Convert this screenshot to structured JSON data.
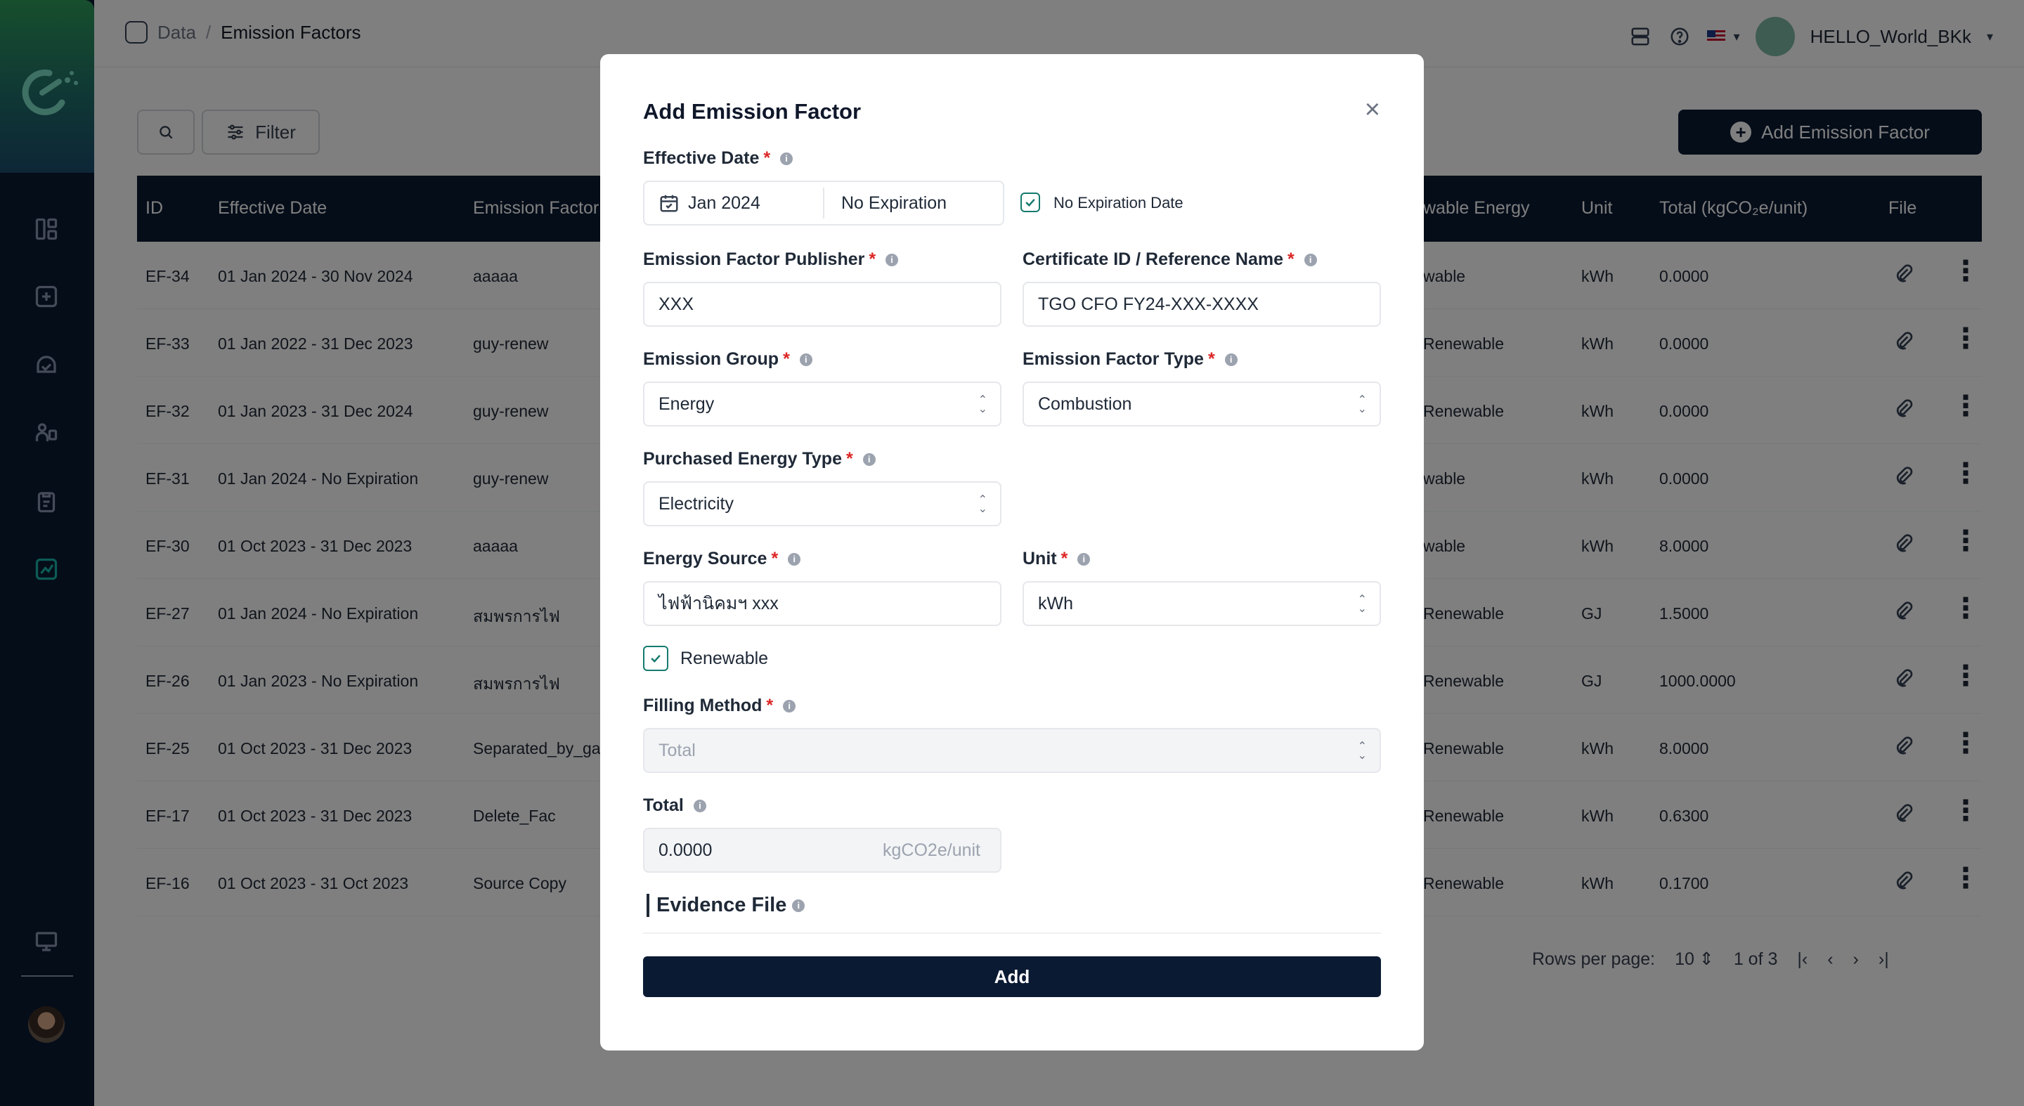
{
  "breadcrumb": {
    "parent": "Data",
    "current": "Emission Factors"
  },
  "header": {
    "username": "HELLO_World_BKk"
  },
  "toolbar": {
    "filter_label": "Filter",
    "add_label": "Add Emission Factor"
  },
  "table": {
    "headers": {
      "id": "ID",
      "effective_date": "Effective Date",
      "emission_factor": "Emission Factor",
      "renewable_energy": "wable Energy",
      "unit": "Unit",
      "total": "Total (kgCO₂e/unit)",
      "file": "File"
    },
    "rows": [
      {
        "id": "EF-34",
        "date": "01 Jan 2024 - 30 Nov 2024",
        "name": "aaaaa",
        "renew": "wable",
        "unit": "kWh",
        "total": "0.0000"
      },
      {
        "id": "EF-33",
        "date": "01 Jan 2022 - 31 Dec 2023",
        "name": "guy-renew",
        "renew": "Renewable",
        "unit": "kWh",
        "total": "0.0000"
      },
      {
        "id": "EF-32",
        "date": "01 Jan 2023 - 31 Dec 2024",
        "name": "guy-renew",
        "renew": "Renewable",
        "unit": "kWh",
        "total": "0.0000"
      },
      {
        "id": "EF-31",
        "date": "01 Jan 2024 - No Expiration",
        "name": "guy-renew",
        "renew": "wable",
        "unit": "kWh",
        "total": "0.0000"
      },
      {
        "id": "EF-30",
        "date": "01 Oct 2023 - 31 Dec 2023",
        "name": "aaaaa",
        "renew": "wable",
        "unit": "kWh",
        "total": "8.0000"
      },
      {
        "id": "EF-27",
        "date": "01 Jan 2024 - No Expiration",
        "name": "สมพรการไฟ",
        "renew": "Renewable",
        "unit": "GJ",
        "total": "1.5000"
      },
      {
        "id": "EF-26",
        "date": "01 Jan 2023 - No Expiration",
        "name": "สมพรการไฟ",
        "renew": "Renewable",
        "unit": "GJ",
        "total": "1000.0000"
      },
      {
        "id": "EF-25",
        "date": "01 Oct 2023 - 31 Dec 2023",
        "name": "Separated_by_gas",
        "renew": "Renewable",
        "unit": "kWh",
        "total": "8.0000"
      },
      {
        "id": "EF-17",
        "date": "01 Oct 2023 - 31 Dec 2023",
        "name": "Delete_Fac",
        "renew": "Renewable",
        "unit": "kWh",
        "total": "0.6300"
      },
      {
        "id": "EF-16",
        "date": "01 Oct 2023 - 31 Oct 2023",
        "name": "Source Copy",
        "renew": "Renewable",
        "unit": "kWh",
        "total": "0.1700"
      }
    ]
  },
  "pagination": {
    "rows_label": "Rows per page:",
    "rows_value": "10",
    "page_info": "1 of 3"
  },
  "modal": {
    "title": "Add Emission Factor",
    "effective_date_label": "Effective Date",
    "start_date": "Jan 2024",
    "end_date": "No Expiration",
    "no_expiration_label": "No Expiration Date",
    "publisher_label": "Emission Factor Publisher",
    "publisher_value": "XXX",
    "certificate_label": "Certificate ID / Reference Name",
    "certificate_value": "TGO CFO FY24-XXX-XXXX",
    "group_label": "Emission Group",
    "group_value": "Energy",
    "type_label": "Emission Factor Type",
    "type_value": "Combustion",
    "purchased_label": "Purchased Energy Type",
    "purchased_value": "Electricity",
    "source_label": "Energy Source",
    "source_value": "ไฟฟ้านิคมฯ xxx",
    "unit_label": "Unit",
    "unit_value": "kWh",
    "renewable_label": "Renewable",
    "filling_label": "Filling Method",
    "filling_value": "Total",
    "total_label": "Total",
    "total_value": "0.0000",
    "total_unit": "kgCO2e/unit",
    "evidence_label": "Evidence File",
    "add_label": "Add"
  },
  "colors": {
    "navy": "#0b1a33",
    "teal": "#157a6e",
    "required": "#dc2626"
  }
}
